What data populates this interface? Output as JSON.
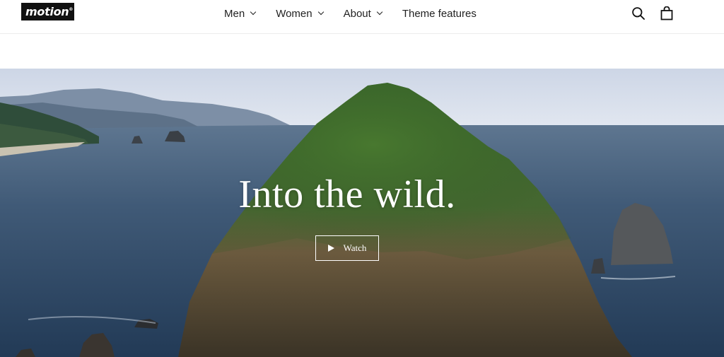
{
  "header": {
    "logo_text": "motion",
    "logo_mark": "®",
    "nav": [
      {
        "label": "Men",
        "has_dropdown": true
      },
      {
        "label": "Women",
        "has_dropdown": true
      },
      {
        "label": "About",
        "has_dropdown": true
      },
      {
        "label": "Theme features",
        "has_dropdown": false
      }
    ],
    "icons": {
      "search": "search-icon",
      "cart": "cart-icon"
    }
  },
  "hero": {
    "title": "Into the wild.",
    "watch_label": "Watch",
    "play_icon": "play-icon"
  },
  "colors": {
    "header_bg": "#ffffff",
    "logo_bg": "#111111",
    "hero_text": "#ffffff",
    "ocean": "#2e4660"
  }
}
